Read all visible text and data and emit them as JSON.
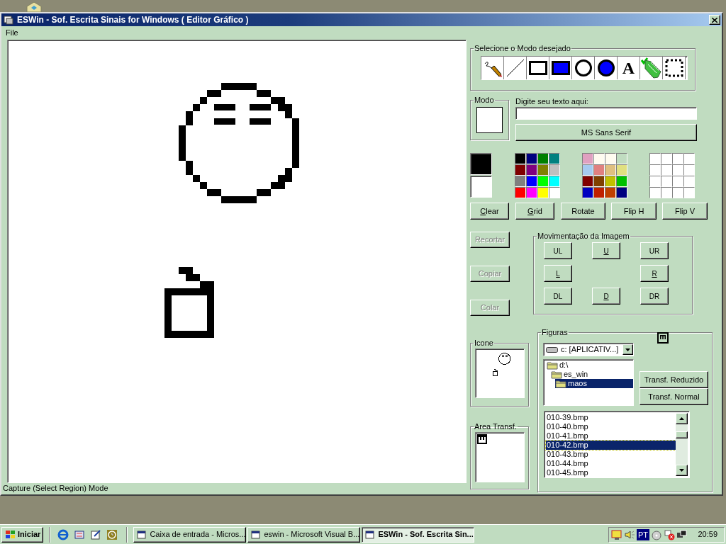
{
  "window": {
    "title": "ESWin - Sof. Escrita Sinais for Windows ( Editor Gráfico )"
  },
  "menu": [
    "File"
  ],
  "tool_group": {
    "title": "Selecione o Modo desejado"
  },
  "tools": [
    {
      "kind": "pencil"
    },
    {
      "kind": "line"
    },
    {
      "kind": "rectangle"
    },
    {
      "kind": "filled-rectangle"
    },
    {
      "kind": "ellipse"
    },
    {
      "kind": "filled-ellipse"
    },
    {
      "kind": "text",
      "label": "A"
    },
    {
      "kind": "fill"
    },
    {
      "kind": "select"
    }
  ],
  "mode_group": {
    "title": "Modo"
  },
  "text_input": {
    "label": "Digite seu texto aqui:"
  },
  "font_button": "MS Sans Serif",
  "current_colors": [
    {
      "color": "#000000"
    },
    {
      "color": "#ffffff"
    }
  ],
  "palettes": [
    {
      "colors": [
        {
          "color": "#000000"
        },
        {
          "color": "#000080"
        },
        {
          "color": "#008000"
        },
        {
          "color": "#008080"
        },
        {
          "color": "#800000"
        },
        {
          "color": "#800080"
        },
        {
          "color": "#808000"
        },
        {
          "color": "#c0c0c0"
        },
        {
          "color": "#808080"
        },
        {
          "color": "#0000ff"
        },
        {
          "color": "#00ff00"
        },
        {
          "color": "#00ffff"
        },
        {
          "color": "#ff0000"
        },
        {
          "color": "#ff00ff"
        },
        {
          "color": "#ffff00"
        },
        {
          "color": "#ffffff"
        }
      ]
    },
    {
      "colors": [
        {
          "color": "#e0a0c0"
        },
        {
          "color": "#fffbf0"
        },
        {
          "color": "#fffbf0"
        },
        {
          "color": "#c0dcc0"
        },
        {
          "color": "#a6caf0"
        },
        {
          "color": "#e08080"
        },
        {
          "color": "#e0c080"
        },
        {
          "color": "#e0e080"
        },
        {
          "color": "#800000"
        },
        {
          "color": "#804000"
        },
        {
          "color": "#c0c000"
        },
        {
          "color": "#00c000"
        },
        {
          "color": "#0000c0"
        },
        {
          "color": "#c02000"
        },
        {
          "color": "#c04000"
        },
        {
          "color": "#000080"
        }
      ]
    },
    {
      "colors": [
        {
          "color": "#ffffff"
        },
        {
          "color": "#ffffff"
        },
        {
          "color": "#ffffff"
        },
        {
          "color": "#ffffff"
        },
        {
          "color": "#ffffff"
        },
        {
          "color": "#ffffff"
        },
        {
          "color": "#ffffff"
        },
        {
          "color": "#ffffff"
        },
        {
          "color": "#ffffff"
        },
        {
          "color": "#ffffff"
        },
        {
          "color": "#ffffff"
        },
        {
          "color": "#ffffff"
        },
        {
          "color": "#ffffff"
        },
        {
          "color": "#ffffff"
        },
        {
          "color": "#ffffff"
        },
        {
          "color": "#ffffff"
        }
      ]
    }
  ],
  "action_buttons": [
    {
      "label": "Clear",
      "underline_first": true
    },
    {
      "label": "Grid",
      "underline_first": true
    },
    {
      "label": "Rotate",
      "underline_first": false
    },
    {
      "label": "Flip H",
      "underline_first": false
    },
    {
      "label": "Flip V",
      "underline_first": false
    }
  ],
  "edit_buttons": [
    {
      "label": "Recortar",
      "disabled": true
    },
    {
      "label": "Copiar",
      "disabled": true
    },
    {
      "label": "Colar",
      "disabled": true
    }
  ],
  "move_group": {
    "title": "Movimentação da Imagem",
    "buttons": [
      {
        "label": "UL",
        "underline_first": false
      },
      {
        "label": "U",
        "underline_first": true
      },
      {
        "label": "UR",
        "underline_first": false
      },
      {
        "label": "L",
        "underline_first": true
      },
      {
        "label": "R",
        "underline_first": true
      },
      {
        "label": "DL",
        "underline_first": false
      },
      {
        "label": "D",
        "underline_first": true
      },
      {
        "label": "DR",
        "underline_first": false
      }
    ]
  },
  "icon_group": {
    "title": "Icone"
  },
  "clipboard_group": {
    "title": "Area Transf."
  },
  "figures": {
    "title": "Figuras",
    "drive": "c: [APLICATIV...]",
    "folders": [
      {
        "label": "d:\\",
        "selected": false,
        "children": [
          {
            "label": "es_win",
            "selected": false,
            "children": [
              {
                "label": "maos",
                "selected": true
              }
            ]
          }
        ]
      }
    ],
    "buttons": [
      "Transf. Reduzido",
      "Transf. Normal"
    ],
    "files": [
      {
        "label": "010-39.bmp",
        "selected": false
      },
      {
        "label": "010-40.bmp",
        "selected": false
      },
      {
        "label": "010-41.bmp",
        "selected": false
      },
      {
        "label": "010-42.bmp",
        "selected": true
      },
      {
        "label": "010-43.bmp",
        "selected": false
      },
      {
        "label": "010-44.bmp",
        "selected": false
      },
      {
        "label": "010-45.bmp",
        "selected": false
      }
    ]
  },
  "status_bar": "Capture (Select Region) Mode",
  "taskbar": {
    "start": "Iniciar",
    "tasks": [
      {
        "label": "Caixa de entrada - Micros...",
        "selected": false
      },
      {
        "label": "eswin - Microsoft Visual B...",
        "selected": false
      },
      {
        "label": "ESWin - Sof. Escrita Sin...",
        "selected": true
      }
    ],
    "language": "PT",
    "clock": "20:59"
  }
}
